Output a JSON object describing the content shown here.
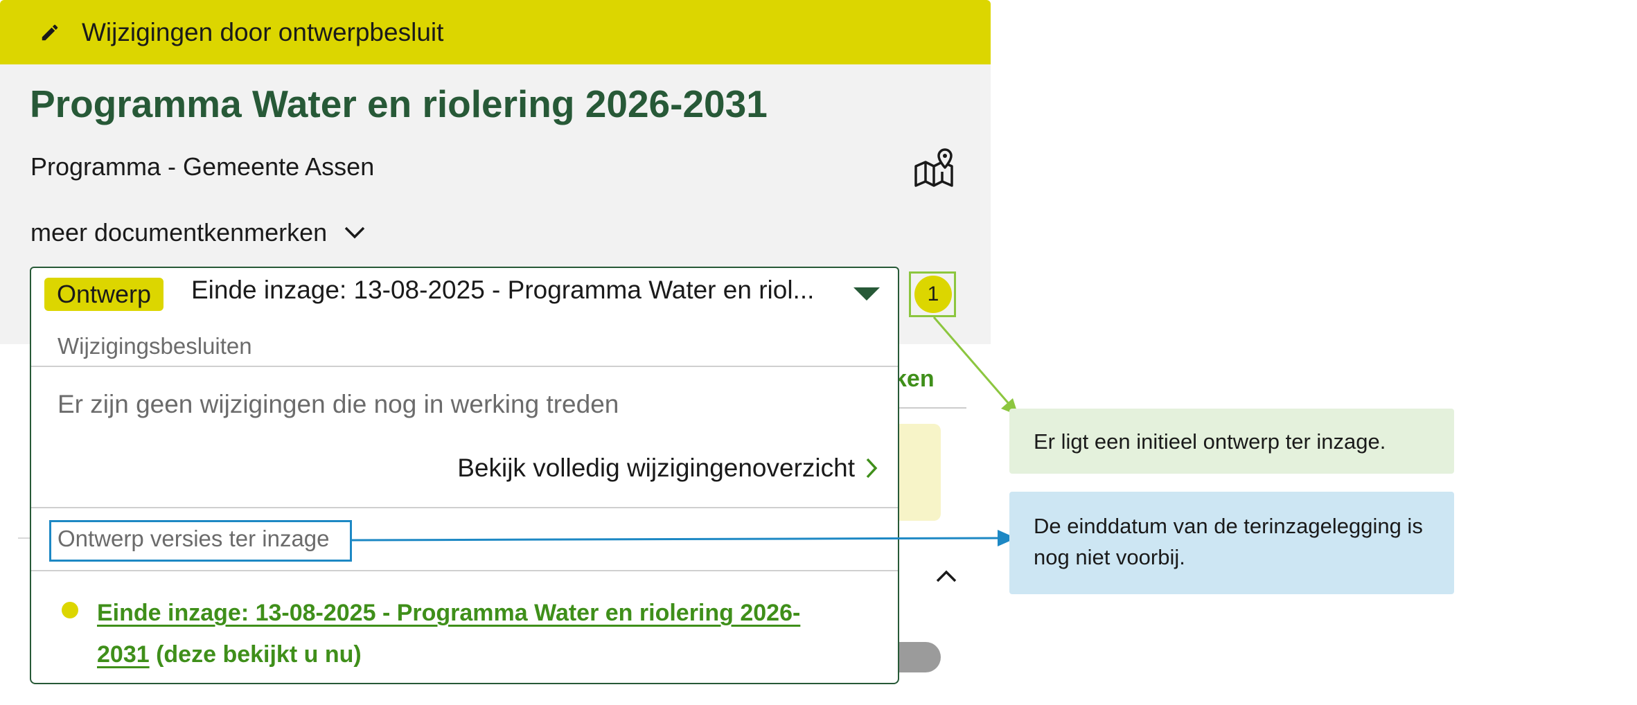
{
  "banner": {
    "text": "Wijzigingen door ontwerpbesluit",
    "icon": "pencil-icon"
  },
  "header": {
    "title": "Programma Water en riolering 2026-2031",
    "subtitle": "Programma - Gemeente Assen",
    "more_label": "meer documentkenmerken",
    "map_icon": "map-pin-icon"
  },
  "version_select": {
    "badge": "Ontwerp",
    "selected_text": "Einde inzage: 13-08-2025 - Programma Water en riol..."
  },
  "dropdown": {
    "section_changes": "Wijzigingsbesluiten",
    "no_changes": "Er zijn geen wijzigingen die nog in werking treden",
    "overview_link": "Bekijk volledig wijzigingenoverzicht",
    "section_drafts": "Ontwerp versies ter inzage",
    "draft_item_link": "Einde inzage: 13-08-2025 - Programma Water en riolering 2026-2031",
    "draft_item_suffix": " (deze bekijkt u nu)"
  },
  "background": {
    "tab_fragment": "ken"
  },
  "annotation": {
    "marker": "1",
    "callout_green": "Er ligt een initieel ontwerp ter inzage.",
    "callout_blue": "De einddatum van de terinzagelegging is nog niet voorbij."
  },
  "colors": {
    "banner_yellow": "#dcd600",
    "title_green": "#275937",
    "link_green": "#3f8f1a",
    "annotation_green": "#8cc63f",
    "annotation_blue": "#1d88c4"
  }
}
